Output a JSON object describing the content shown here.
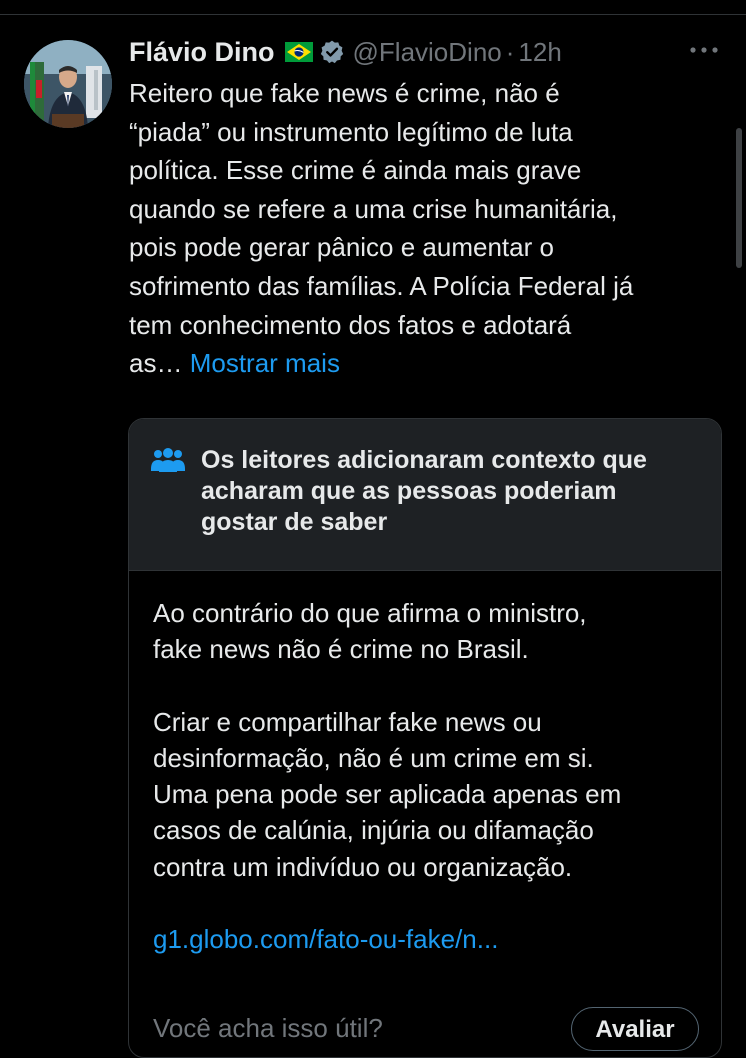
{
  "tweet": {
    "author_name": "Flávio Dino",
    "flag_icon": "brazil-flag-icon",
    "verified_icon": "verified-badge-icon",
    "handle": "@FlavioDino",
    "separator": "·",
    "time": "12h",
    "more_icon": "more-options-icon",
    "text_lines": [
      "Reitero que fake news é crime, não é",
      "“piada” ou instrumento legítimo de luta",
      "política. Esse crime é ainda mais grave",
      "quando se refere a uma crise humanitária,",
      "pois pode gerar pânico e aumentar o",
      "sofrimento das famílias. A Polícia Federal já",
      "tem conhecimento dos fatos e adotará"
    ],
    "text_last_line": "as…",
    "show_more": "Mostrar mais"
  },
  "community_note": {
    "icon": "people-icon",
    "title_lines": [
      "Os leitores adicionaram contexto que",
      "acharam que as pessoas poderiam",
      "gostar de saber"
    ],
    "paragraph_1_lines": [
      "Ao contrário do que afirma o ministro,",
      "fake news não é crime no Brasil."
    ],
    "paragraph_2_lines": [
      "Criar e compartilhar fake news ou",
      "desinformação, não é um crime em si.",
      "Uma pena pode ser aplicada apenas em",
      "casos de calúnia, injúria ou difamação",
      "contra um indivíduo ou organização."
    ],
    "link": "g1.globo.com/fato-ou-fake/n...",
    "footer_text": "Você acha isso útil?",
    "rate_button": "Avaliar"
  },
  "colors": {
    "background": "#000000",
    "text": "#e7e9ea",
    "secondary_text": "#71767b",
    "link": "#1d9bf0",
    "note_header_bg": "#1e2124",
    "border": "#2f3336"
  }
}
